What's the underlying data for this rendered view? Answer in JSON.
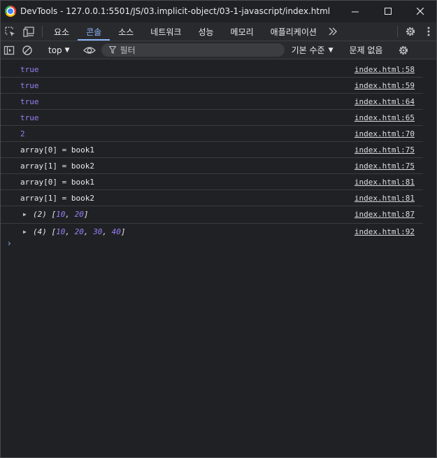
{
  "window": {
    "title": "DevTools - 127.0.0.1:5501/JS/03.implicit-object/03-1-javascript/index.html",
    "min_icon": "minimize-icon",
    "max_icon": "maximize-icon",
    "close_icon": "close-icon"
  },
  "tabs": {
    "items": [
      "요소",
      "콘솔",
      "소스",
      "네트워크",
      "성능",
      "메모리",
      "애플리케이션"
    ],
    "active": "콘솔",
    "accent": "#8ab4f8"
  },
  "toolbar": {
    "context": "top",
    "filter_placeholder": "필터",
    "levels": "기본 수준",
    "issues": "문제 없음"
  },
  "console": {
    "lines": [
      {
        "text": "true",
        "source": "index.html:58"
      },
      {
        "text": "true",
        "source": "index.html:59"
      },
      {
        "text": "true",
        "source": "index.html:64"
      },
      {
        "text": "true",
        "source": "index.html:65"
      },
      {
        "text": "2",
        "source": "index.html:70"
      },
      {
        "text": "array[0] = book1",
        "source": "index.html:75"
      },
      {
        "text": "array[1] = book2",
        "source": "index.html:75"
      },
      {
        "text": "array[0] = book1",
        "source": "index.html:81"
      },
      {
        "text": "array[1] = book2",
        "source": "index.html:81"
      }
    ],
    "objects": [
      {
        "prefix": "(2) [",
        "values": [
          "10",
          "20"
        ],
        "source": "index.html:87"
      },
      {
        "prefix": "(4) [",
        "values": [
          "10",
          "20",
          "30",
          "40"
        ],
        "source": "index.html:92"
      }
    ],
    "prompt": "›",
    "value_color": "#9a7ff9"
  }
}
